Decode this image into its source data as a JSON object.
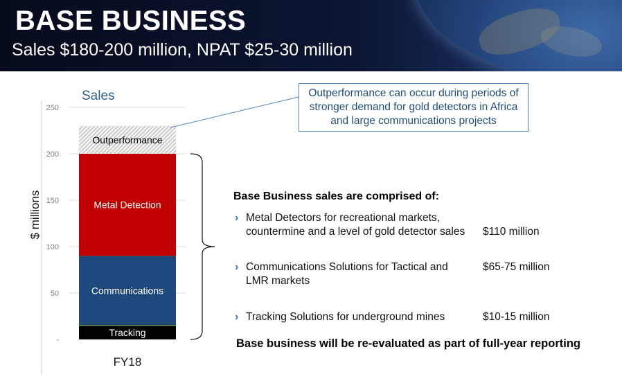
{
  "header": {
    "title": "BASE BUSINESS",
    "subtitle": "Sales $180-200 million, NPAT $25-30 million"
  },
  "chart_data": {
    "type": "bar",
    "stacked": true,
    "title": "Sales",
    "ylabel": "$ millions",
    "xlabel": "",
    "categories": [
      "FY18"
    ],
    "ylim": [
      0,
      250
    ],
    "yticks": [
      "-",
      "50",
      "100",
      "150",
      "200",
      "250"
    ],
    "grid": true,
    "legend": "none",
    "series": [
      {
        "name": "Tracking",
        "values": [
          15
        ],
        "color": "#000000"
      },
      {
        "name": "Communications",
        "values": [
          75
        ],
        "color": "#1f497d"
      },
      {
        "name": "Metal Detection",
        "values": [
          110
        ],
        "color": "#c00000"
      },
      {
        "name": "Outperformance",
        "values": [
          30
        ],
        "color": "#d9d9d9",
        "pattern": "hatched"
      }
    ]
  },
  "callout": {
    "lines": [
      "Outperformance can occur during periods of",
      "stronger demand for gold detectors in Africa",
      "and large communications projects"
    ]
  },
  "panel": {
    "heading": "Base Business sales are comprised of:",
    "items": [
      {
        "lines": [
          "Metal Detectors for recreational markets,",
          "countermine and a level of gold detector sales"
        ],
        "value": "$110 million"
      },
      {
        "lines": [
          "Communications Solutions for Tactical and",
          "LMR markets"
        ],
        "value": "$65-75 million"
      },
      {
        "lines": [
          "Tracking Solutions for underground mines"
        ],
        "value": "$10-15 million"
      }
    ],
    "footer": "Base business will be re-evaluated as part of full-year reporting"
  },
  "colors": {
    "banner": "#0b1430",
    "accent_blue": "#2e75b6",
    "callout_border": "#4f81bd",
    "callout_text": "#1f4e79"
  }
}
